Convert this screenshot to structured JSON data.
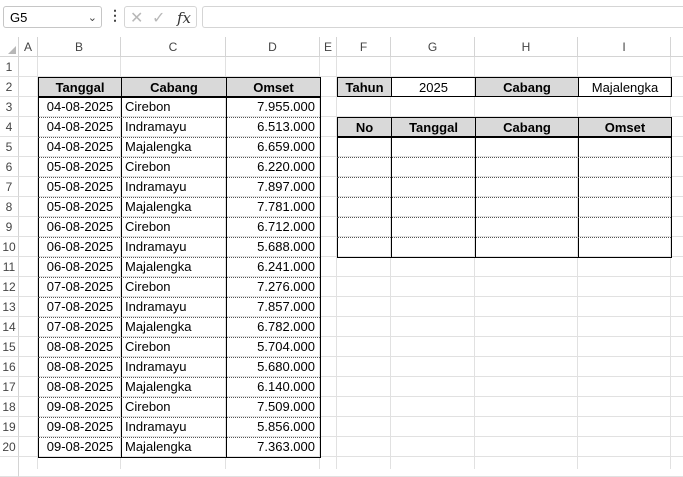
{
  "formula_bar": {
    "name_box": "G5",
    "name_box_dropdown_icon": "chevron-down-icon",
    "more_icon": "vertical-dots-icon",
    "cancel_icon": "close-icon",
    "enter_icon": "check-icon",
    "fx_label": "fx",
    "formula_value": ""
  },
  "columns": [
    "A",
    "B",
    "C",
    "D",
    "E",
    "F",
    "G",
    "H",
    "I"
  ],
  "rows": [
    "1",
    "2",
    "3",
    "4",
    "5",
    "6",
    "7",
    "8",
    "9",
    "10",
    "11",
    "12",
    "13",
    "14",
    "15",
    "16",
    "17",
    "18",
    "19",
    "20"
  ],
  "table1": {
    "headers": [
      "Tanggal",
      "Cabang",
      "Omset"
    ],
    "rows": [
      [
        "04-08-2025",
        "Cirebon",
        "7.955.000"
      ],
      [
        "04-08-2025",
        "Indramayu",
        "6.513.000"
      ],
      [
        "04-08-2025",
        "Majalengka",
        "6.659.000"
      ],
      [
        "05-08-2025",
        "Cirebon",
        "6.220.000"
      ],
      [
        "05-08-2025",
        "Indramayu",
        "7.897.000"
      ],
      [
        "05-08-2025",
        "Majalengka",
        "7.781.000"
      ],
      [
        "06-08-2025",
        "Cirebon",
        "6.712.000"
      ],
      [
        "06-08-2025",
        "Indramayu",
        "5.688.000"
      ],
      [
        "06-08-2025",
        "Majalengka",
        "6.241.000"
      ],
      [
        "07-08-2025",
        "Cirebon",
        "7.276.000"
      ],
      [
        "07-08-2025",
        "Indramayu",
        "7.857.000"
      ],
      [
        "07-08-2025",
        "Majalengka",
        "6.782.000"
      ],
      [
        "08-08-2025",
        "Cirebon",
        "5.704.000"
      ],
      [
        "08-08-2025",
        "Indramayu",
        "5.680.000"
      ],
      [
        "08-08-2025",
        "Majalengka",
        "6.140.000"
      ],
      [
        "09-08-2025",
        "Cirebon",
        "7.509.000"
      ],
      [
        "09-08-2025",
        "Indramayu",
        "5.856.000"
      ],
      [
        "09-08-2025",
        "Majalengka",
        "7.363.000"
      ]
    ]
  },
  "filter": {
    "tahun_label": "Tahun",
    "tahun_value": "2025",
    "cabang_label": "Cabang",
    "cabang_value": "Majalengka"
  },
  "table2": {
    "headers": [
      "No",
      "Tanggal",
      "Cabang",
      "Omset"
    ],
    "empty_rows": 6
  },
  "colors": {
    "header_fill": "#d9d9d9",
    "gridline": "#e1e1e1"
  }
}
